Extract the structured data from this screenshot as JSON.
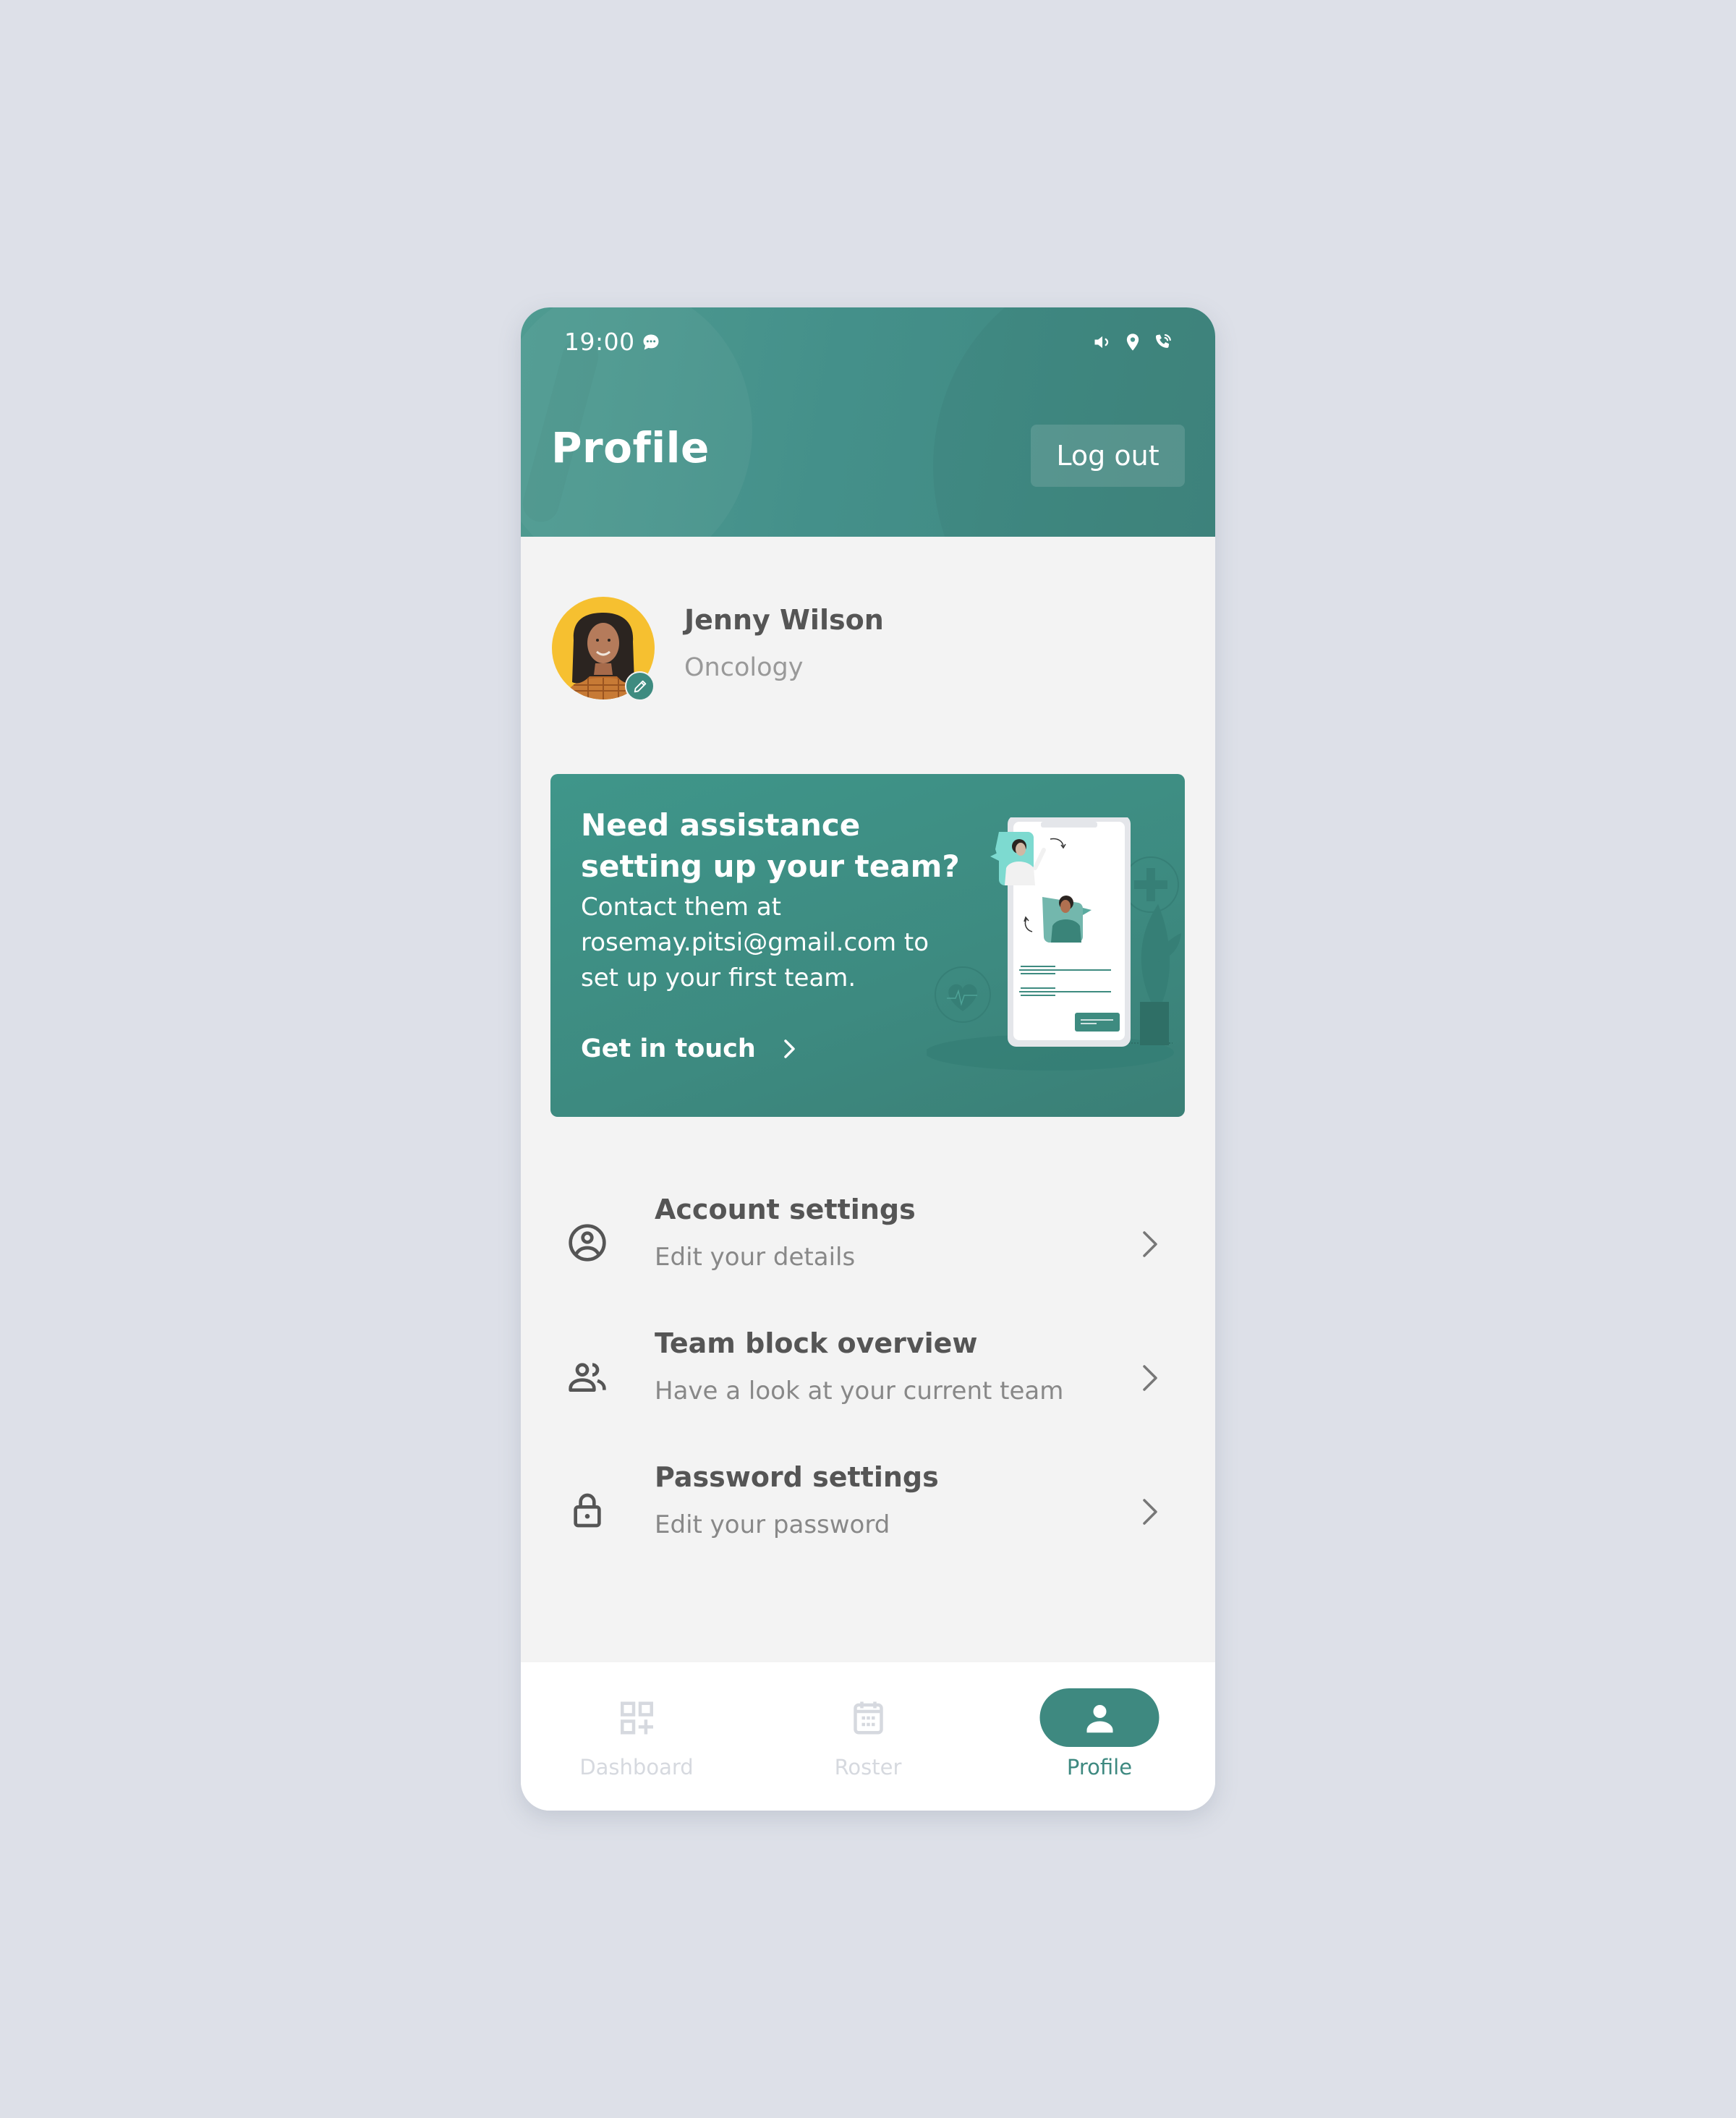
{
  "colors": {
    "primary": "#3e8980",
    "header_bg": "#46928a",
    "avatar_bg": "#f6c030",
    "text_dark": "#555555",
    "text_muted": "#888888",
    "nav_inactive": "#d6d9df",
    "page_bg": "#dde0e8"
  },
  "status_bar": {
    "time": "19:00",
    "left_icons": [
      "message-icon"
    ],
    "right_icons": [
      "volume-icon",
      "location-icon",
      "phone-call-icon"
    ]
  },
  "header": {
    "title": "Profile",
    "logout_label": "Log out"
  },
  "profile": {
    "name": "Jenny Wilson",
    "department": "Oncology",
    "avatar_icon": "user-avatar",
    "edit_icon": "pencil-icon"
  },
  "assist_card": {
    "title": "Need assistance setting up your team?",
    "body": "Contact them at rosemay.pitsi@gmail.com to set up your first team.",
    "cta_label": "Get in touch",
    "cta_icon": "chevron-right-icon"
  },
  "settings": [
    {
      "title": "Account settings",
      "subtitle": "Edit your details",
      "icon": "user-circle-icon"
    },
    {
      "title": "Team block overview",
      "subtitle": "Have a look at your current team",
      "icon": "users-icon"
    },
    {
      "title": "Password settings",
      "subtitle": "Edit your password",
      "icon": "lock-icon"
    }
  ],
  "nav": {
    "items": [
      {
        "label": "Dashboard",
        "icon": "dashboard-icon",
        "active": false
      },
      {
        "label": "Roster",
        "icon": "calendar-icon",
        "active": false
      },
      {
        "label": "Profile",
        "icon": "user-icon",
        "active": true
      }
    ]
  }
}
